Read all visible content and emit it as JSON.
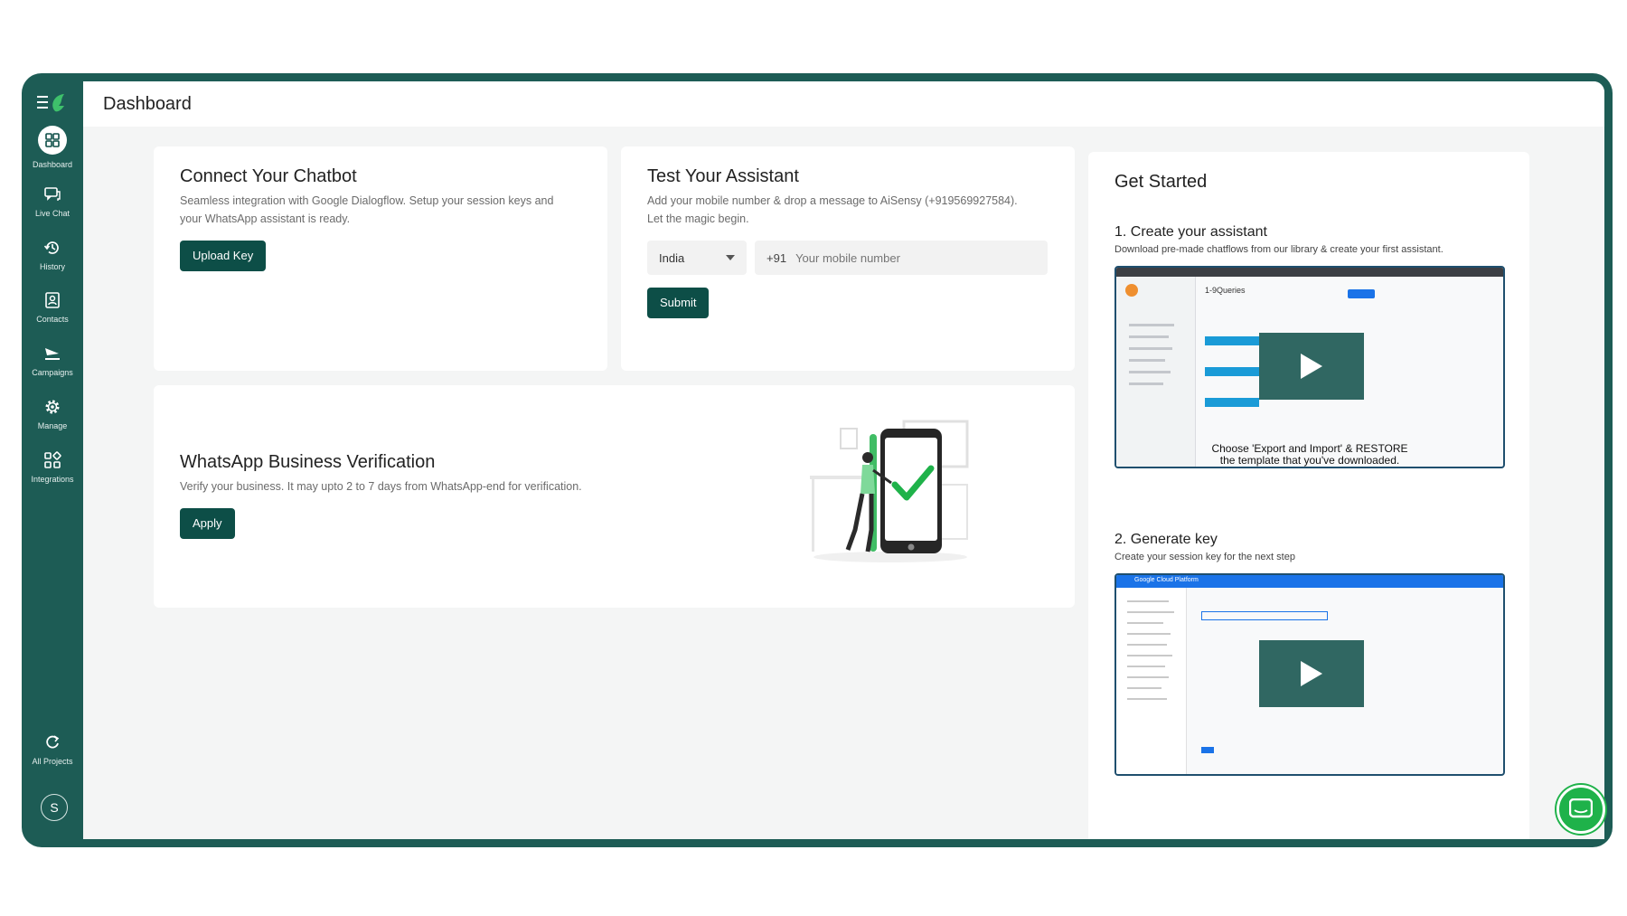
{
  "header": {
    "title": "Dashboard"
  },
  "sidebar": {
    "items": [
      {
        "label": "Dashboard",
        "icon": "dashboard-icon"
      },
      {
        "label": "Live Chat",
        "icon": "chat-icon"
      },
      {
        "label": "History",
        "icon": "history-icon"
      },
      {
        "label": "Contacts",
        "icon": "contacts-icon"
      },
      {
        "label": "Campaigns",
        "icon": "send-icon"
      },
      {
        "label": "Manage",
        "icon": "gear-icon"
      },
      {
        "label": "Integrations",
        "icon": "integrations-icon"
      }
    ],
    "all_projects": {
      "label": "All Projects",
      "icon": "refresh-icon"
    },
    "avatar_initial": "S"
  },
  "connect": {
    "title": "Connect Your Chatbot",
    "desc_line1": "Seamless integration with Google Dialogflow. Setup your session keys and",
    "desc_line2": "your WhatsApp assistant is ready.",
    "button": "Upload Key"
  },
  "test": {
    "title": "Test Your Assistant",
    "desc_line1": "Add your mobile number & drop a message to AiSensy (+919569927584).",
    "desc_line2": "Let the magic begin.",
    "country": "India",
    "prefix": "+91",
    "phone_placeholder": "Your mobile number",
    "button": "Submit"
  },
  "verification": {
    "title": "WhatsApp Business Verification",
    "desc": "Verify your business. It may upto 2 to 7 days from WhatsApp-end for verification.",
    "button": "Apply"
  },
  "get_started": {
    "title": "Get Started",
    "step1": {
      "title": "1. Create your assistant",
      "desc": "Download pre-made chatflows from our library & create your first assistant.",
      "video_caption_line1": "Choose 'Export and Import' & RESTORE",
      "video_caption_line2": "the template that you've downloaded.",
      "video_tab": "1-9Queries"
    },
    "step2": {
      "title": "2. Generate key",
      "desc": "Create your session key for the next step",
      "video_header": "Google Cloud Platform"
    }
  },
  "colors": {
    "brand_dark": "#0d4e47",
    "frame": "#1d5c55",
    "accent_green": "#1fb24a"
  }
}
